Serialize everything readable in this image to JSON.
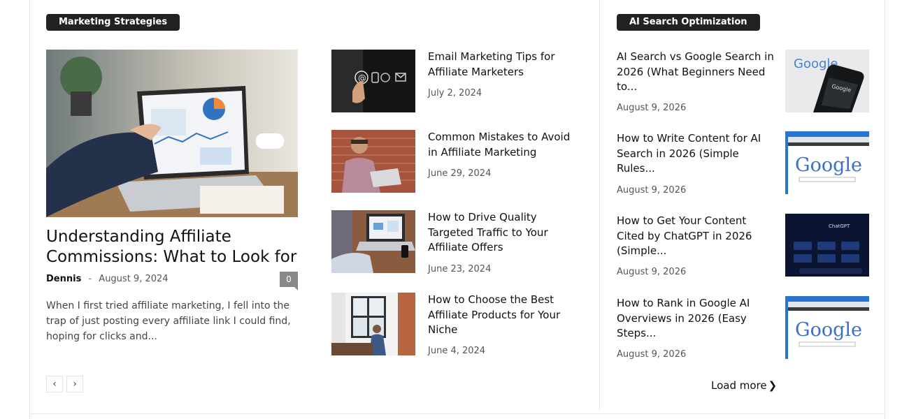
{
  "left_section": {
    "category": "Marketing Strategies",
    "featured": {
      "title": "Understanding Affiliate Commissions: What to Look for",
      "author": "Dennis",
      "separator": "-",
      "date": "August 9, 2024",
      "comments": "0",
      "excerpt": "When I first tried affiliate marketing, I fell into the trap of just posting every affiliate link I could find, hoping for clicks and..."
    },
    "items": [
      {
        "title": "Email Marketing Tips for Affiliate Marketers",
        "date": "July 2, 2024"
      },
      {
        "title": "Common Mistakes to Avoid in Affiliate Marketing",
        "date": "June 29, 2024"
      },
      {
        "title": "How to Drive Quality Targeted Traffic to Your Affiliate Offers",
        "date": "June 23, 2024"
      },
      {
        "title": "How to Choose the Best Affiliate Products for Your Niche",
        "date": "June 4, 2024"
      }
    ],
    "pager": {
      "prev": "‹",
      "next": "›"
    }
  },
  "right_section": {
    "category": "AI Search Optimization",
    "items": [
      {
        "title": "AI Search vs Google Search in 2026 (What Beginners Need to...",
        "date": "August 9, 2026",
        "thumb_text": "Google"
      },
      {
        "title": "How to Write Content for AI Search in 2026 (Simple Rules...",
        "date": "August 9, 2026",
        "thumb_text": "Google"
      },
      {
        "title": "How to Get Your Content Cited by ChatGPT in 2026 (Simple...",
        "date": "August 9, 2026",
        "thumb_text": "ChatGPT"
      },
      {
        "title": "How to Rank in Google AI Overviews in 2026 (Easy Steps...",
        "date": "August 9, 2026",
        "thumb_text": "Google"
      }
    ],
    "load_more": "Load more",
    "load_more_chevron": "❯"
  }
}
